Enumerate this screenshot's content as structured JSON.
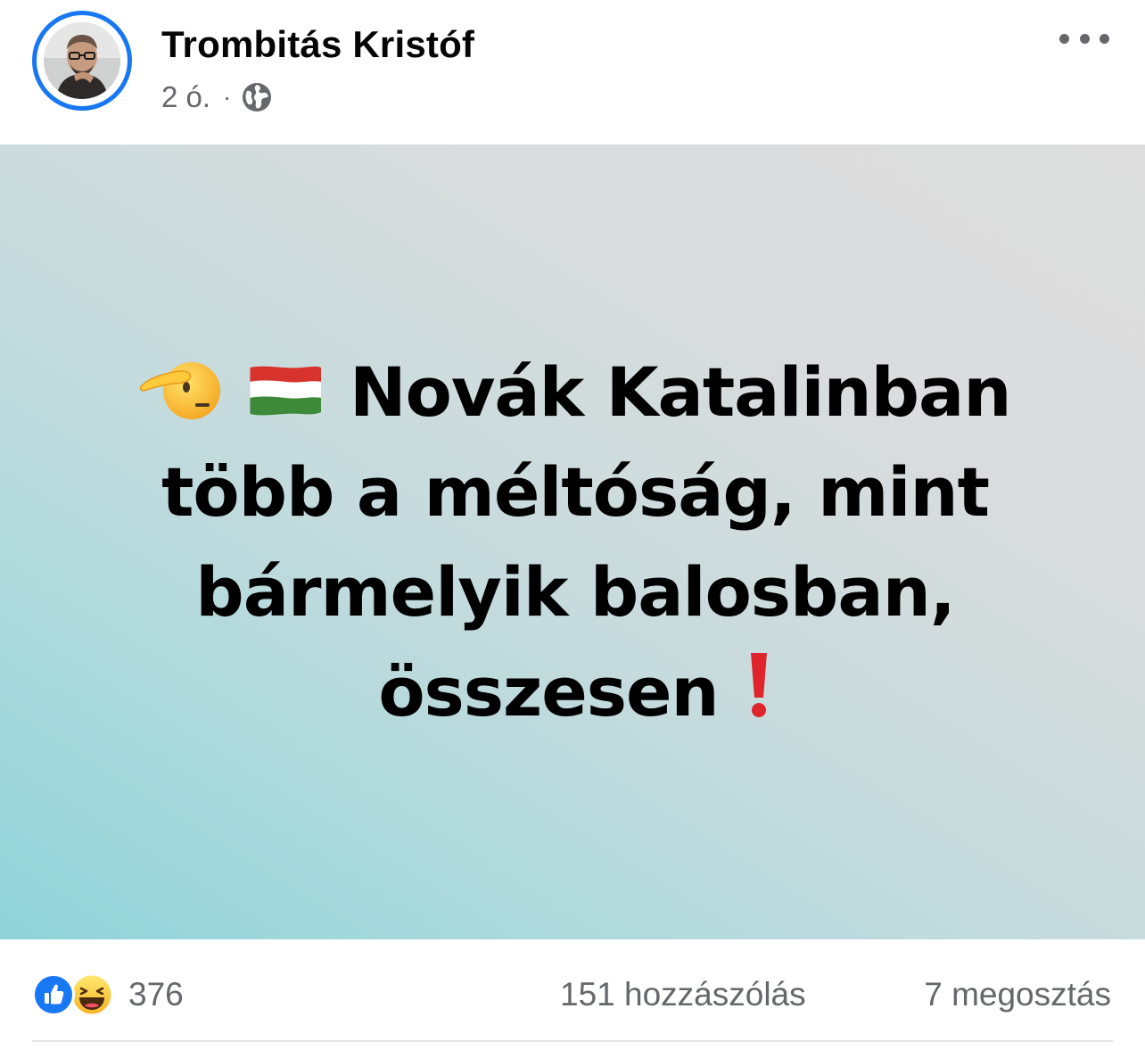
{
  "post": {
    "author": {
      "name": "Trombitás Kristóf",
      "avatar_icon": "profile-photo"
    },
    "meta": {
      "time": "2 ó.",
      "separator": "·",
      "audience_icon": "globe-icon"
    },
    "menu_icon": "more-dots-icon",
    "image_text": {
      "line1": "Novák Katalinban",
      "line2": "több a méltóság, mint",
      "line3": "bármelyik balosban,",
      "line4": "összesen",
      "emojis": [
        "saluting-face-emoji",
        "hungary-flag-emoji",
        "red-exclamation-emoji"
      ]
    },
    "stats": {
      "reaction_icons": [
        "like-icon",
        "haha-icon"
      ],
      "reaction_count": "376",
      "comments": "151 hozzászólás",
      "shares": "7 megosztás"
    }
  },
  "colors": {
    "accent": "#1877f2",
    "text_primary": "#050505",
    "text_secondary": "#65676b",
    "image_gradient_start": "#dddddd",
    "image_gradient_end": "#8fd3d8"
  }
}
